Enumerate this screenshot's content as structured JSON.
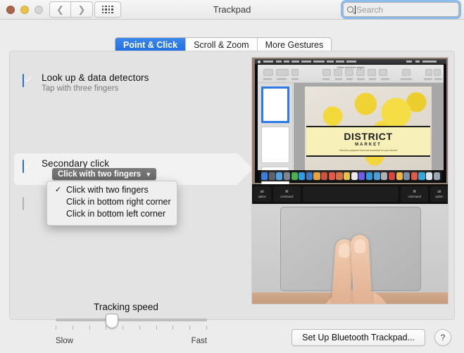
{
  "window": {
    "title": "Trackpad",
    "traffic_lights": [
      "close",
      "minimize",
      "zoom"
    ],
    "nav_back_icon": "chevron-left-icon",
    "nav_forward_icon": "chevron-right-icon",
    "show_all_icon": "grid-icon"
  },
  "search": {
    "placeholder": "Search",
    "value": "",
    "icon": "search-icon"
  },
  "tabs": [
    {
      "label": "Point & Click",
      "active": true
    },
    {
      "label": "Scroll & Zoom",
      "active": false
    },
    {
      "label": "More Gestures",
      "active": false
    }
  ],
  "options": [
    {
      "title": "Look up & data detectors",
      "subtitle": "Tap with three fingers",
      "checked": true
    },
    {
      "title": "Secondary click",
      "subtitle": "",
      "checked": true,
      "popup_value": "Click with two fingers",
      "popup_chevron_icon": "chevron-down-icon"
    },
    {
      "title": "",
      "subtitle": "",
      "checked": false
    }
  ],
  "dropdown": {
    "open": true,
    "selected_index": 0,
    "check_glyph": "✓",
    "items": [
      "Click with two fingers",
      "Click in bottom right corner",
      "Click in bottom left corner"
    ]
  },
  "slider": {
    "label": "Tracking speed",
    "min_label": "Slow",
    "max_label": "Fast",
    "value_percent": 37,
    "tick_count": 10
  },
  "preview": {
    "document_title": "DISTRICT",
    "document_subtitle": "MARKET",
    "document_tagline": "Flavorful, prepared food and essentials for your kitchen",
    "window_title": "Class-overview-pages",
    "keys": [
      {
        "glyph": "alt",
        "label": "option"
      },
      {
        "glyph": "⌘",
        "label": "command"
      },
      {
        "glyph": "",
        "label": ""
      },
      {
        "glyph": "⌘",
        "label": "command"
      },
      {
        "glyph": "alt",
        "label": "option"
      }
    ],
    "dock_colors": [
      "#3b7ddd",
      "#5a6370",
      "#4fa3e3",
      "#7d8590",
      "#4caf50",
      "#2f9de0",
      "#3c78c8",
      "#e8a33d",
      "#c8553d",
      "#e05a47",
      "#d6713f",
      "#e0c24a",
      "#eaeaea",
      "#6c5ce7",
      "#2d98da",
      "#4b9fd5",
      "#b0b0b0",
      "#d64541",
      "#e8b84b",
      "#7f8fa6",
      "#e05a47",
      "#3aa6d8",
      "#d9e4ec",
      "#9aa7b2"
    ]
  },
  "footer": {
    "bluetooth_button": "Set Up Bluetooth Trackpad...",
    "help_label": "?"
  },
  "colors": {
    "accent_blue": "#2d7ae4",
    "content_bg": "#e3e3e3",
    "window_bg": "#ececec",
    "highlight_band": "#f2f2f2",
    "popup_gray": "#6f6f6f"
  }
}
